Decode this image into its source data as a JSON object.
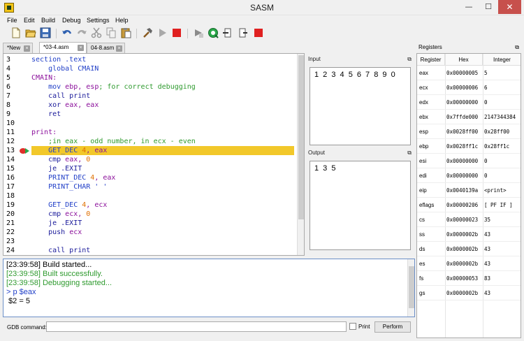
{
  "window": {
    "title": "SASM",
    "minimize": "—",
    "maximize": "☐",
    "close": "✕"
  },
  "menu": [
    "File",
    "Edit",
    "Build",
    "Debug",
    "Settings",
    "Help"
  ],
  "toolbar": {
    "icons": [
      "new-file-icon",
      "open-folder-icon",
      "save-icon",
      "undo-icon",
      "redo-icon",
      "cut-icon",
      "copy-icon",
      "paste-icon",
      "build-hammer-icon",
      "run-icon",
      "stop-icon",
      "debug-step-icon",
      "debug-continue-icon",
      "step-into-icon",
      "step-over-icon",
      "debug-stop-icon"
    ]
  },
  "tabs": [
    {
      "label": "*New",
      "close": "×"
    },
    {
      "label": "*03-4.asm",
      "close": "×"
    },
    {
      "label": "04-8.asm",
      "close": "×"
    }
  ],
  "editor": {
    "current_line": 13,
    "lines": [
      {
        "n": "3",
        "parts": [
          {
            "t": "section .text",
            "c": "kw-blue"
          }
        ]
      },
      {
        "n": "4",
        "parts": [
          {
            "t": "    global CMAIN",
            "c": "kw-blue"
          }
        ]
      },
      {
        "n": "5",
        "parts": [
          {
            "t": "CMAIN:",
            "c": "kw-purple"
          }
        ]
      },
      {
        "n": "6",
        "parts": [
          {
            "t": "    mov ",
            "c": "kw-blue"
          },
          {
            "t": "ebp, esp",
            "c": "kw-purple"
          },
          {
            "t": "; for correct debugging",
            "c": "kw-green"
          }
        ]
      },
      {
        "n": "7",
        "parts": [
          {
            "t": "    call print",
            "c": "kw-navy"
          }
        ]
      },
      {
        "n": "8",
        "parts": [
          {
            "t": "    xor ",
            "c": "kw-navy"
          },
          {
            "t": "eax, eax",
            "c": "kw-purple"
          }
        ]
      },
      {
        "n": "9",
        "parts": [
          {
            "t": "    ret",
            "c": "kw-navy"
          }
        ]
      },
      {
        "n": "10",
        "parts": []
      },
      {
        "n": "11",
        "parts": [
          {
            "t": "print:",
            "c": "kw-purple"
          }
        ]
      },
      {
        "n": "12",
        "parts": [
          {
            "t": "    ;in eax - odd number, in ecx - even",
            "c": "kw-green"
          }
        ]
      },
      {
        "n": "13",
        "parts": [
          {
            "t": "    GET_DEC ",
            "c": "kw-blue"
          },
          {
            "t": "4",
            "c": "kw-orange"
          },
          {
            "t": ", eax",
            "c": "kw-purple"
          }
        ]
      },
      {
        "n": "14",
        "parts": [
          {
            "t": "    cmp ",
            "c": "kw-navy"
          },
          {
            "t": "eax, ",
            "c": "kw-purple"
          },
          {
            "t": "0",
            "c": "kw-orange"
          }
        ]
      },
      {
        "n": "15",
        "parts": [
          {
            "t": "    je .EXIT",
            "c": "kw-navy"
          }
        ]
      },
      {
        "n": "16",
        "parts": [
          {
            "t": "    PRINT_DEC ",
            "c": "kw-blue"
          },
          {
            "t": "4",
            "c": "kw-orange"
          },
          {
            "t": ", eax",
            "c": "kw-purple"
          }
        ]
      },
      {
        "n": "17",
        "parts": [
          {
            "t": "    PRINT_CHAR ' '",
            "c": "kw-blue"
          }
        ]
      },
      {
        "n": "18",
        "parts": []
      },
      {
        "n": "19",
        "parts": [
          {
            "t": "    GET_DEC ",
            "c": "kw-blue"
          },
          {
            "t": "4",
            "c": "kw-orange"
          },
          {
            "t": ", ecx",
            "c": "kw-purple"
          }
        ]
      },
      {
        "n": "20",
        "parts": [
          {
            "t": "    cmp ",
            "c": "kw-navy"
          },
          {
            "t": "ecx, ",
            "c": "kw-purple"
          },
          {
            "t": "0",
            "c": "kw-orange"
          }
        ]
      },
      {
        "n": "21",
        "parts": [
          {
            "t": "    je .EXIT",
            "c": "kw-navy"
          }
        ]
      },
      {
        "n": "22",
        "parts": [
          {
            "t": "    push ",
            "c": "kw-navy"
          },
          {
            "t": "ecx",
            "c": "kw-purple"
          }
        ]
      },
      {
        "n": "23",
        "parts": []
      },
      {
        "n": "24",
        "parts": [
          {
            "t": "    call print",
            "c": "kw-navy"
          }
        ]
      }
    ]
  },
  "input_panel": {
    "title": "Input",
    "dock": "⧉",
    "value": "1 2 3 4 5 6 7 8 9 0"
  },
  "output_panel": {
    "title": "Output",
    "dock": "⧉",
    "value": "1 3 5"
  },
  "log": [
    {
      "text": "[23:39:58] Build started...",
      "color": "#000000"
    },
    {
      "text": "[23:39:58] Built successfully.",
      "color": "#2e9a2e"
    },
    {
      "text": "[23:39:58] Debugging started...",
      "color": "#2e9a2e"
    },
    {
      "text": "> p $eax",
      "color": "#2240c8"
    },
    {
      "text": " $2 = 5",
      "color": "#000000"
    }
  ],
  "gdb": {
    "label": "GDB command:",
    "value": "",
    "print_label": "Print",
    "print_checked": false,
    "perform_label": "Perform"
  },
  "registers": {
    "title": "Registers",
    "dock": "⧉",
    "columns": [
      "Register",
      "Hex",
      "Integer"
    ],
    "rows": [
      [
        "eax",
        "0x00000005",
        "5"
      ],
      [
        "ecx",
        "0x00000006",
        "6"
      ],
      [
        "edx",
        "0x00000000",
        "0"
      ],
      [
        "ebx",
        "0x7ffde000",
        "2147344384"
      ],
      [
        "esp",
        "0x0028ff00",
        "0x28ff00"
      ],
      [
        "ebp",
        "0x0028ff1c",
        "0x28ff1c"
      ],
      [
        "esi",
        "0x00000000",
        "0"
      ],
      [
        "edi",
        "0x00000000",
        "0"
      ],
      [
        "eip",
        "0x0040139a",
        "<print>"
      ],
      [
        "eflags",
        "0x00000206",
        "[ PF IF ]"
      ],
      [
        "cs",
        "0x00000023",
        "35"
      ],
      [
        "ss",
        "0x0000002b",
        "43"
      ],
      [
        "ds",
        "0x0000002b",
        "43"
      ],
      [
        "es",
        "0x0000002b",
        "43"
      ],
      [
        "fs",
        "0x00000053",
        "83"
      ],
      [
        "gs",
        "0x0000002b",
        "43"
      ]
    ]
  }
}
